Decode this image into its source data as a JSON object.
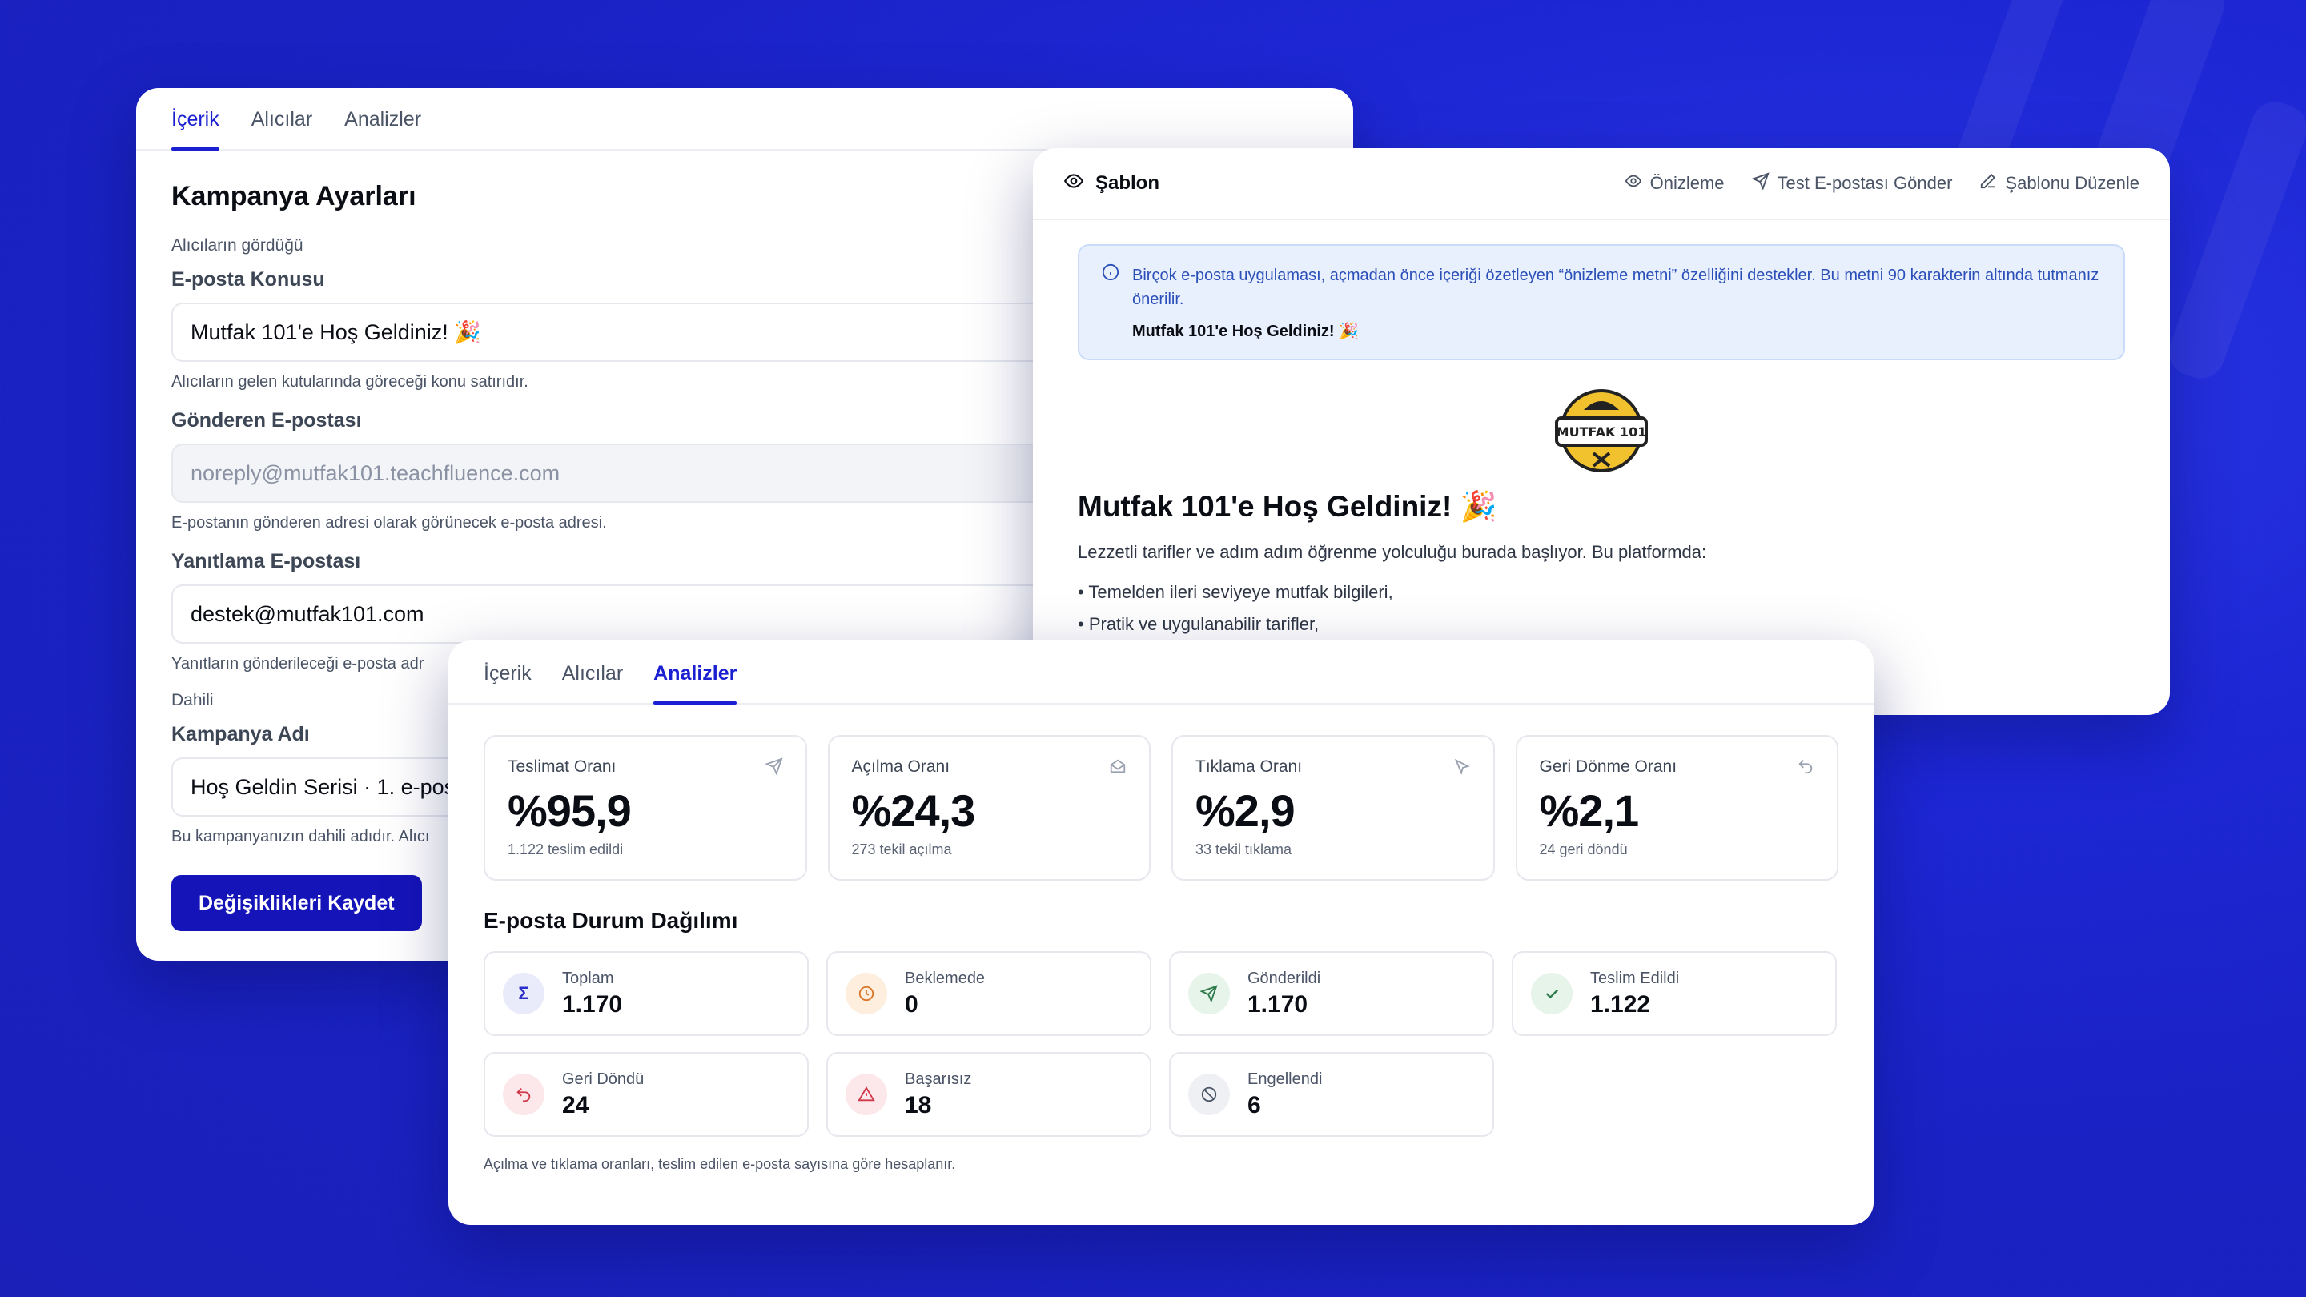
{
  "settings": {
    "tabs": [
      "İçerik",
      "Alıcılar",
      "Analizler"
    ],
    "title": "Kampanya Ayarları",
    "section_public": "Alıcıların gördüğü",
    "subject_label": "E-posta Konusu",
    "subject_value": "Mutfak 101'e Hoş Geldiniz! 🎉",
    "subject_help": "Alıcıların gelen kutularında göreceği konu satırıdır.",
    "from_label": "Gönderen E-postası",
    "from_value": "noreply@mutfak101.teachfluence.com",
    "from_help": "E-postanın gönderen adresi olarak görünecek e-posta adresi.",
    "reply_label": "Yanıtlama E-postası",
    "reply_value": "destek@mutfak101.com",
    "reply_help": "Yanıtların gönderileceği e-posta adr",
    "section_internal": "Dahili",
    "campaign_label": "Kampanya Adı",
    "campaign_value": "Hoş Geldin Serisi · 1. e-pos",
    "campaign_help": "Bu kampanyanızın dahili adıdır. Alıcı",
    "save_label": "Değişiklikleri Kaydet"
  },
  "template": {
    "title": "Şablon",
    "actions": {
      "preview": "Önizleme",
      "test": "Test E-postası Gönder",
      "edit": "Şablonu Düzenle"
    },
    "info_text": "Birçok e-posta uygulaması, açmadan önce içeriği özetleyen “önizleme metni” özelliğini destekler. Bu metni 90 karakterin altında tutmanız önerilir.",
    "info_preview": "Mutfak 101'e Hoş Geldiniz! 🎉",
    "logo_text": "MUTFAK 101",
    "heading": "Mutfak 101'e Hoş Geldiniz! 🎉",
    "intro": "Lezzetli tarifler ve adım adım öğrenme yolculuğu burada başlıyor. Bu platformda:",
    "bullets": [
      "• Temelden ileri seviyeye mutfak bilgileri,",
      "• Pratik ve uygulanabilir tarifler,"
    ]
  },
  "analytics": {
    "tabs": [
      "İçerik",
      "Alıcılar",
      "Analizler"
    ],
    "stats": [
      {
        "label": "Teslimat Oranı",
        "value": "%95,9",
        "sub": "1.122 teslim edildi",
        "icon": "send-icon"
      },
      {
        "label": "Açılma Oranı",
        "value": "%24,3",
        "sub": "273 tekil açılma",
        "icon": "mail-open-icon"
      },
      {
        "label": "Tıklama Oranı",
        "value": "%2,9",
        "sub": "33 tekil tıklama",
        "icon": "cursor-icon"
      },
      {
        "label": "Geri Dönme Oranı",
        "value": "%2,1",
        "sub": "24 geri döndü",
        "icon": "undo-icon"
      }
    ],
    "distribution_title": "E-posta Durum Dağılımı",
    "statuses": [
      {
        "label": "Toplam",
        "value": "1.170",
        "icon": "sigma-icon",
        "color": "#2b2fc9",
        "bg": "#e9ebfb"
      },
      {
        "label": "Beklemede",
        "value": "0",
        "icon": "clock-icon",
        "color": "#d9772b",
        "bg": "#fdeedd"
      },
      {
        "label": "Gönderildi",
        "value": "1.170",
        "icon": "send-icon",
        "color": "#2e7a4a",
        "bg": "#e6f4ea"
      },
      {
        "label": "Teslim Edildi",
        "value": "1.122",
        "icon": "check-icon",
        "color": "#2e7a4a",
        "bg": "#e6f4ea"
      },
      {
        "label": "Geri Döndü",
        "value": "24",
        "icon": "undo-icon",
        "color": "#d1384a",
        "bg": "#fce8ea"
      },
      {
        "label": "Başarısız",
        "value": "18",
        "icon": "warning-icon",
        "color": "#d1384a",
        "bg": "#fce8ea"
      },
      {
        "label": "Engellendi",
        "value": "6",
        "icon": "ban-icon",
        "color": "#4a5466",
        "bg": "#eef0f3"
      }
    ],
    "footnote": "Açılma ve tıklama oranları, teslim edilen e-posta sayısına göre hesaplanır."
  }
}
